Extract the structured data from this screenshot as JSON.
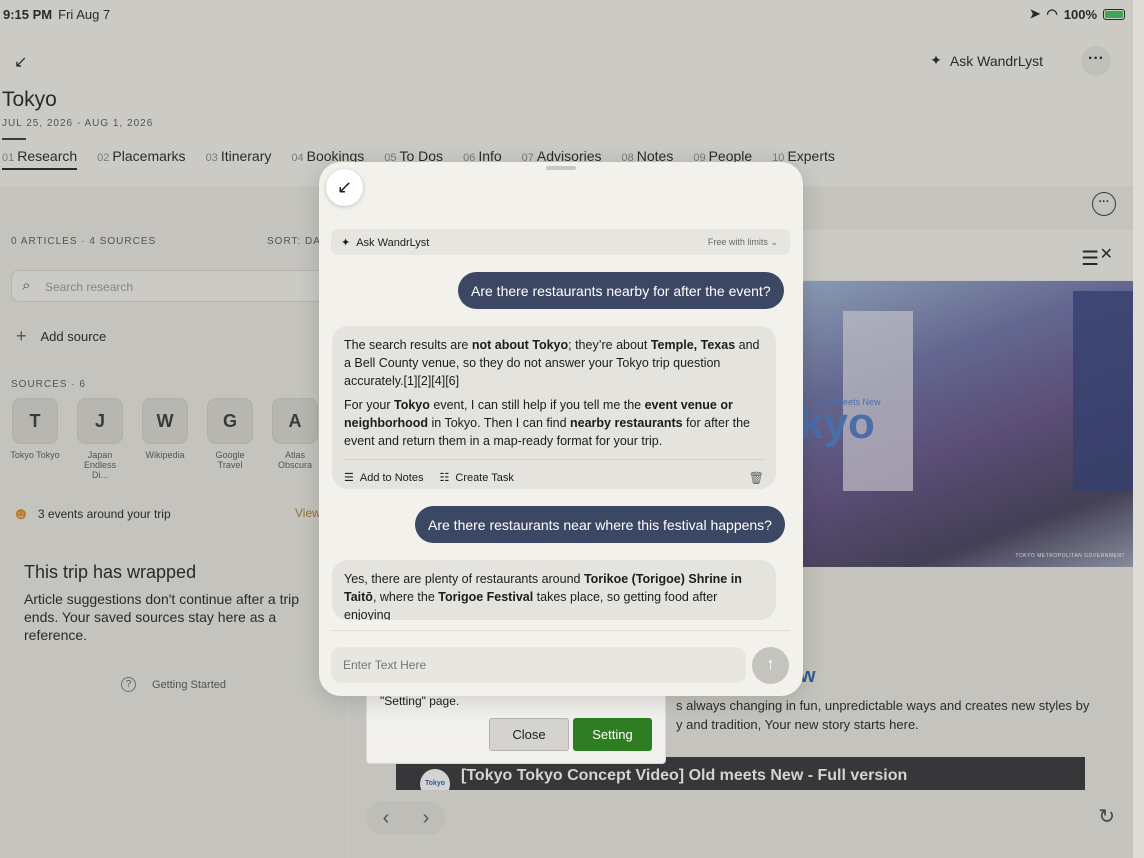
{
  "statusbar": {
    "time": "9:15 PM",
    "date": "Fri Aug 7",
    "battery": "100%"
  },
  "header": {
    "ask_label": "Ask WandrLyst",
    "title": "Tokyo",
    "dates": "JUL 25, 2026 - AUG 1, 2026"
  },
  "tabs": [
    {
      "num": "01",
      "label": "Research"
    },
    {
      "num": "02",
      "label": "Placemarks"
    },
    {
      "num": "03",
      "label": "Itinerary"
    },
    {
      "num": "04",
      "label": "Bookings"
    },
    {
      "num": "05",
      "label": "To Dos"
    },
    {
      "num": "06",
      "label": "Info"
    },
    {
      "num": "07",
      "label": "Advisories"
    },
    {
      "num": "08",
      "label": "Notes"
    },
    {
      "num": "09",
      "label": "People"
    },
    {
      "num": "10",
      "label": "Experts"
    }
  ],
  "sidebar": {
    "meta": "0 ARTICLES · 4 SOURCES",
    "sort": "SORT: DAT",
    "search_placeholder": "Search research",
    "add_source": "Add source",
    "sources_label": "SOURCES · 6",
    "sources": [
      {
        "letter": "T",
        "name": "Tokyo Tokyo"
      },
      {
        "letter": "J",
        "name": "Japan Endless Di..."
      },
      {
        "letter": "W",
        "name": "Wikipedia"
      },
      {
        "letter": "G",
        "name": "Google Travel"
      },
      {
        "letter": "A",
        "name": "Atlas Obscura"
      }
    ],
    "events": "3 events around your trip",
    "events_view": "View",
    "wrapped_title": "This trip has wrapped",
    "wrapped_text": "Article suggestions don't continue after a trip ends. Your saved sources stay here as a reference.",
    "getting_started": "Getting Started"
  },
  "article": {
    "hero_text": "kyo",
    "hero_small": "Old meets New",
    "hero_credit": "TOKYO METROPOLITAN GOVERNMENT",
    "heading_tail": "w",
    "body": "s always changing in fun, unpredictable ways and creates new styles by y and tradition, Your new story starts here.",
    "video_title": "[Tokyo Tokyo Concept Video] Old meets New - Full version",
    "video_logo": "Tokyo Tokyo"
  },
  "alert": {
    "message": "\"Setting\" page.",
    "close": "Close",
    "setting": "Setting"
  },
  "chat": {
    "ask_label": "Ask WandrLyst",
    "plan": "Free with limits",
    "user_msg_1": "Are there restaurants nearby for after the event?",
    "bot_1_p1": "The search results are <b>not about Tokyo</b>; they’re about <b>Temple, Texas</b> and a Bell County venue, so they do not answer your Tokyo trip question accurately.[1][2][4][6]",
    "bot_1_p2": "For your <b>Tokyo</b> event, I can still help if you tell me the <b>event venue or neighborhood</b> in Tokyo. Then I can find <b>nearby restaurants</b> for after the event and return them in a map-ready format for your trip.",
    "add_to_notes": "Add to Notes",
    "create_task": "Create Task",
    "user_msg_2": "Are there restaurants near where this festival happens?",
    "bot_2_p1": "Yes, there are plenty of restaurants around <b>Torikoe (Torigoe) Shrine in Taitō</b>, where the <b>Torigoe Festival</b> takes place, so getting food after enjoying",
    "input_placeholder": "Enter Text Here"
  }
}
